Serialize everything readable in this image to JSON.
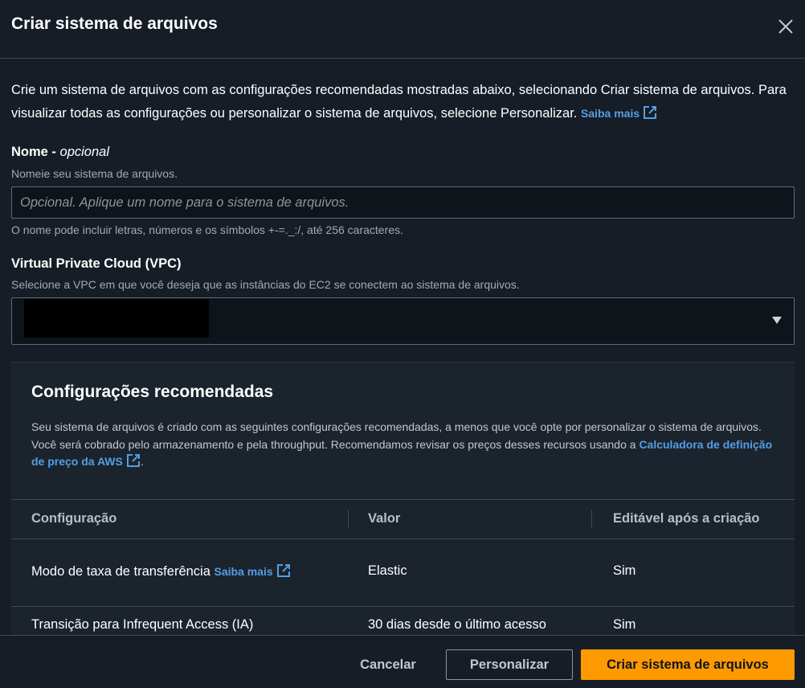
{
  "dialog": {
    "title": "Criar sistema de arquivos"
  },
  "intro": {
    "text": "Crie um sistema de arquivos com as configurações recomendadas mostradas abaixo, selecionando Criar sistema de arquivos. Para visualizar todas as configurações ou personalizar o sistema de arquivos, selecione Personalizar.",
    "learn_more": "Saiba mais"
  },
  "name_field": {
    "label": "Nome -",
    "optional": "opcional",
    "description": "Nomeie seu sistema de arquivos.",
    "placeholder": "Opcional. Aplique um nome para o sistema de arquivos.",
    "value": "",
    "hint": "O nome pode incluir letras, números e os símbolos +-=._:/, até 256 caracteres."
  },
  "vpc_field": {
    "label": "Virtual Private Cloud (VPC)",
    "description": "Selecione a VPC em que você deseja que as instâncias do EC2 se conectem ao sistema de arquivos."
  },
  "recommended": {
    "title": "Configurações recomendadas",
    "description": "Seu sistema de arquivos é criado com as seguintes configurações recomendadas, a menos que você opte por personalizar o sistema de arquivos. Você será cobrado pelo armazenamento e pela throughput. Recomendamos revisar os preços desses recursos usando a",
    "pricing_link": "Calculadora de definição de preço da AWS",
    "columns": [
      "Configuração",
      "Valor",
      "Editável após a criação"
    ],
    "rows": [
      {
        "config": "Modo de taxa de transferência",
        "link": "Saiba mais",
        "value": "Elastic",
        "editable": "Sim"
      },
      {
        "config": "Transição para Infrequent Access (IA)",
        "link": "",
        "value": "30 dias desde o último acesso",
        "editable": "Sim"
      }
    ]
  },
  "footer": {
    "cancel": "Cancelar",
    "customize": "Personalizar",
    "create": "Criar sistema de arquivos"
  },
  "colors": {
    "accent": "#ff9900",
    "link": "#539fe5",
    "background": "#161d26"
  }
}
